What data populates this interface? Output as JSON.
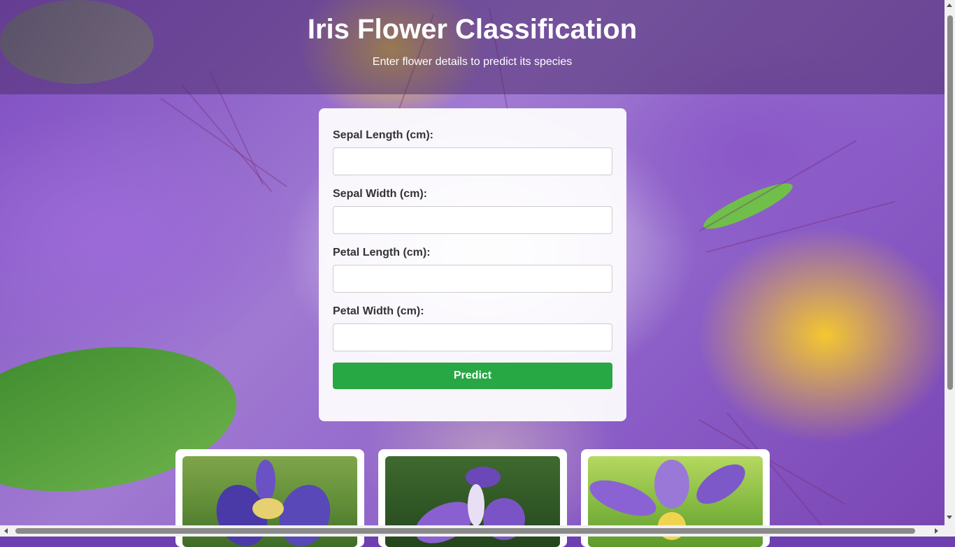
{
  "header": {
    "title": "Iris Flower Classification",
    "subtitle": "Enter flower details to predict its species"
  },
  "form": {
    "fields": [
      {
        "label": "Sepal Length (cm):",
        "value": ""
      },
      {
        "label": "Sepal Width (cm):",
        "value": ""
      },
      {
        "label": "Petal Length (cm):",
        "value": ""
      },
      {
        "label": "Petal Width (cm):",
        "value": ""
      }
    ],
    "submit_label": "Predict",
    "submit_color": "#28a745"
  },
  "gallery": {
    "images": [
      "iris-flower-photo-1",
      "iris-flower-photo-2",
      "iris-flower-photo-3"
    ]
  },
  "colors": {
    "header_overlay": "#50326e",
    "accent_green": "#28a745"
  }
}
